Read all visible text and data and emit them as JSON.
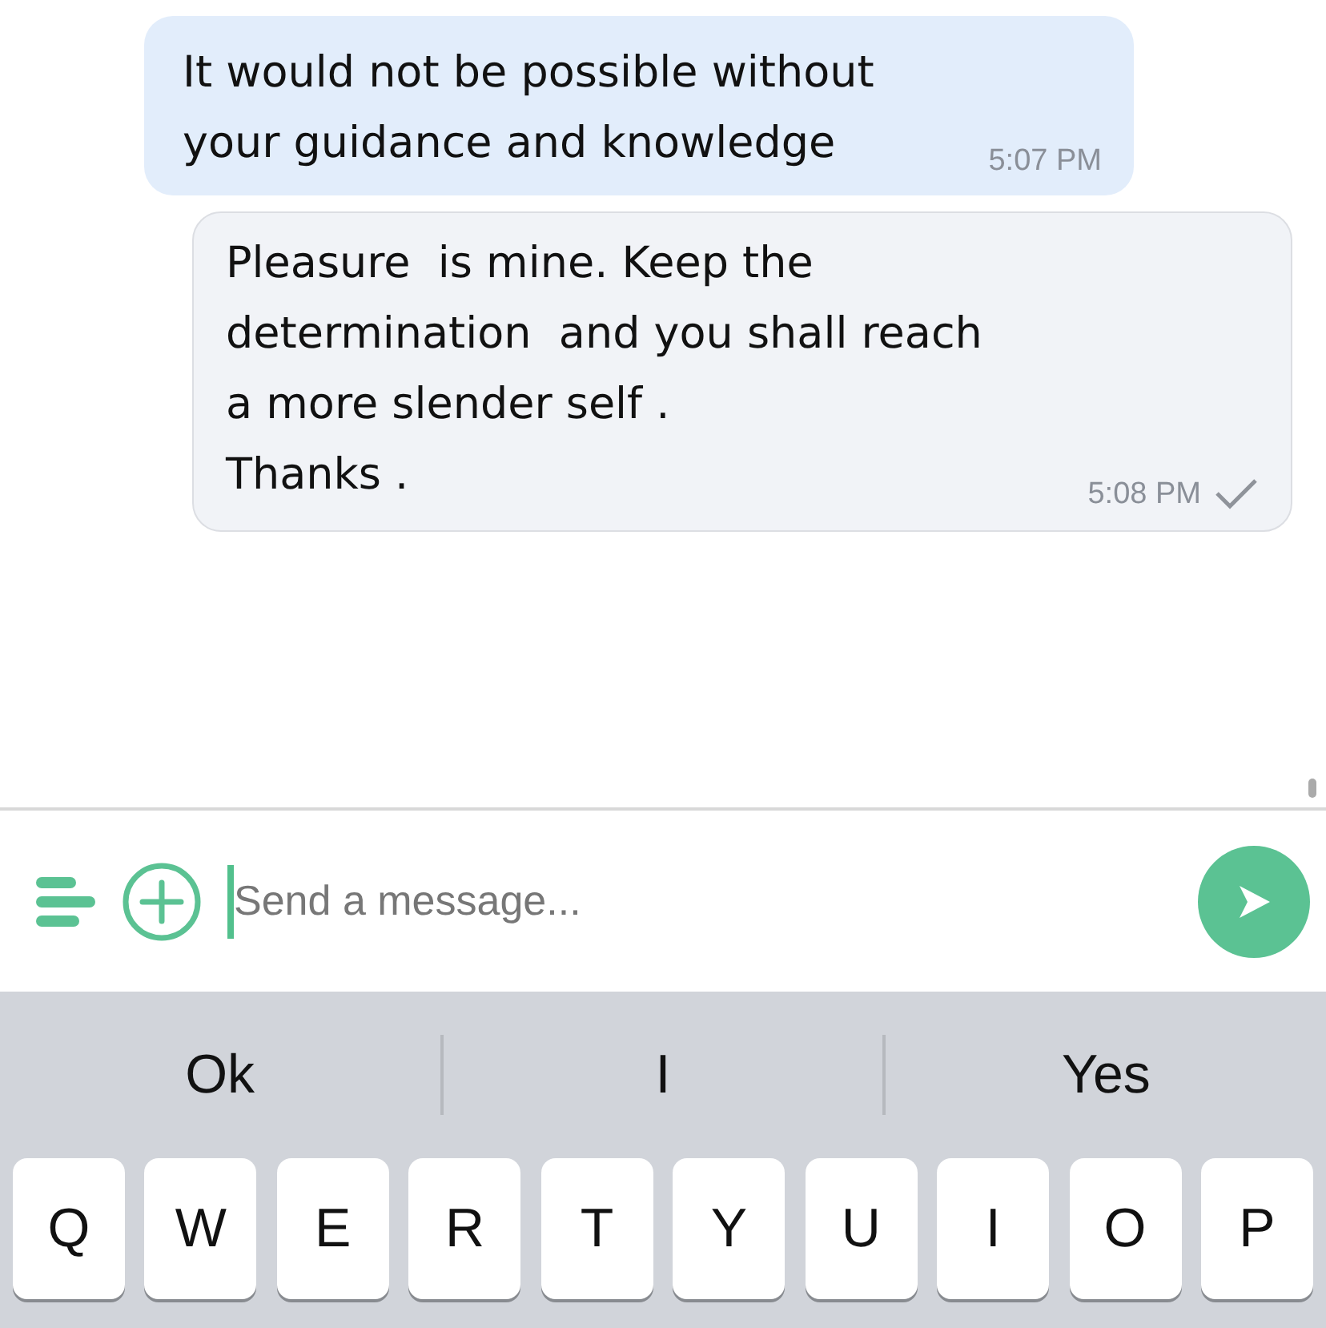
{
  "messages": [
    {
      "kind": "received",
      "lines": [
        "It would not be possible without",
        "your guidance and knowledge"
      ],
      "time": "5:07 PM",
      "delivered": false
    },
    {
      "kind": "sent",
      "lines": [
        "Pleasure  is mine. Keep the",
        "determination  and you shall reach",
        "a more slender self .",
        "Thanks ."
      ],
      "time": "5:08 PM",
      "delivered": true
    }
  ],
  "composer": {
    "placeholder": "Send a message..."
  },
  "suggestions": [
    "Ok",
    "I",
    "Yes"
  ],
  "keys": [
    "Q",
    "W",
    "E",
    "R",
    "T",
    "Y",
    "U",
    "I",
    "O",
    "P"
  ]
}
